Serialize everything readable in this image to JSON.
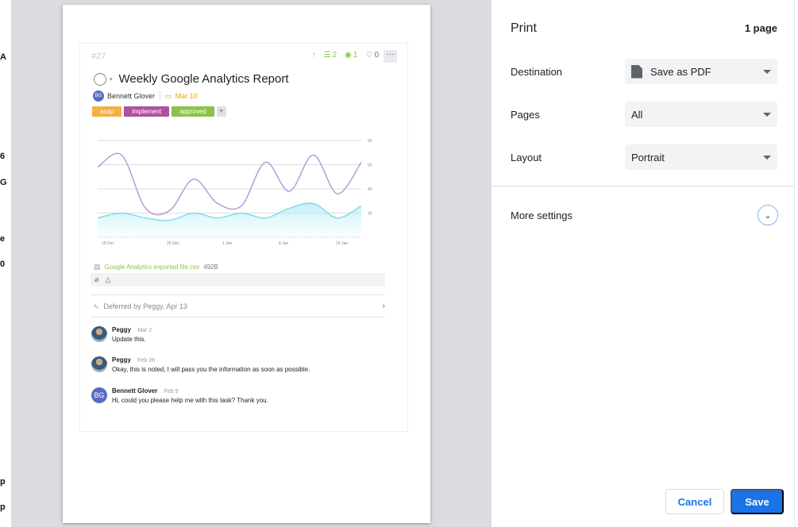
{
  "colors": {
    "purple_line": "#b39ddb",
    "teal_line": "#80deea",
    "primary_blue": "#1a73e8",
    "tag_asap": "#f4b042",
    "tag_implement": "#b050a0",
    "tag_approved": "#8bc34a"
  },
  "preview": {
    "task": {
      "number": "#27",
      "meta": {
        "subtasks": "2",
        "watchers": "1",
        "likes": "0"
      },
      "title": "Weekly Google Analytics Report",
      "assignee": "Bennett Glover",
      "assignee_initials": "BG",
      "due_date": "Mar 10",
      "tags": [
        {
          "label": "asap"
        },
        {
          "label": "implement"
        },
        {
          "label": "approved"
        }
      ],
      "tag_add": "+",
      "file": {
        "name": "Google Analytics exported file.csv",
        "size": "492B"
      },
      "activity": "Deferred by Peggy, Apr 13",
      "comments": [
        {
          "author": "Peggy",
          "date": "Mar 2",
          "text": "Update this."
        },
        {
          "author": "Peggy",
          "date": "Feb 26",
          "text": "Okay, this is noted, I will pass you the information as soon as possible."
        },
        {
          "author": "Bennett Glover",
          "date": "Feb 9",
          "text": "Hi, could you please help me with this task? Thank you.",
          "initials": "BG"
        }
      ]
    }
  },
  "chart_data": {
    "type": "line",
    "x": [
      "18 Dec",
      "25 Dec",
      "1 Jan",
      "8 Jan",
      "15 Jan"
    ],
    "ylim": [
      20,
      60
    ],
    "yticks": [
      "60",
      "50",
      "40",
      "30"
    ],
    "series": [
      {
        "values": [
          49,
          54,
          32,
          31,
          44,
          34,
          33,
          51,
          39,
          54,
          38,
          51
        ]
      },
      {
        "values": [
          28,
          30,
          28,
          27,
          30,
          28,
          30,
          28,
          32,
          34,
          28,
          33
        ]
      }
    ],
    "grid": true
  },
  "panel": {
    "title": "Print",
    "page_count": "1 page",
    "destination_label": "Destination",
    "destination_value": "Save as PDF",
    "pages_label": "Pages",
    "pages_value": "All",
    "layout_label": "Layout",
    "layout_value": "Portrait",
    "more_settings": "More settings",
    "cancel": "Cancel",
    "save": "Save"
  }
}
